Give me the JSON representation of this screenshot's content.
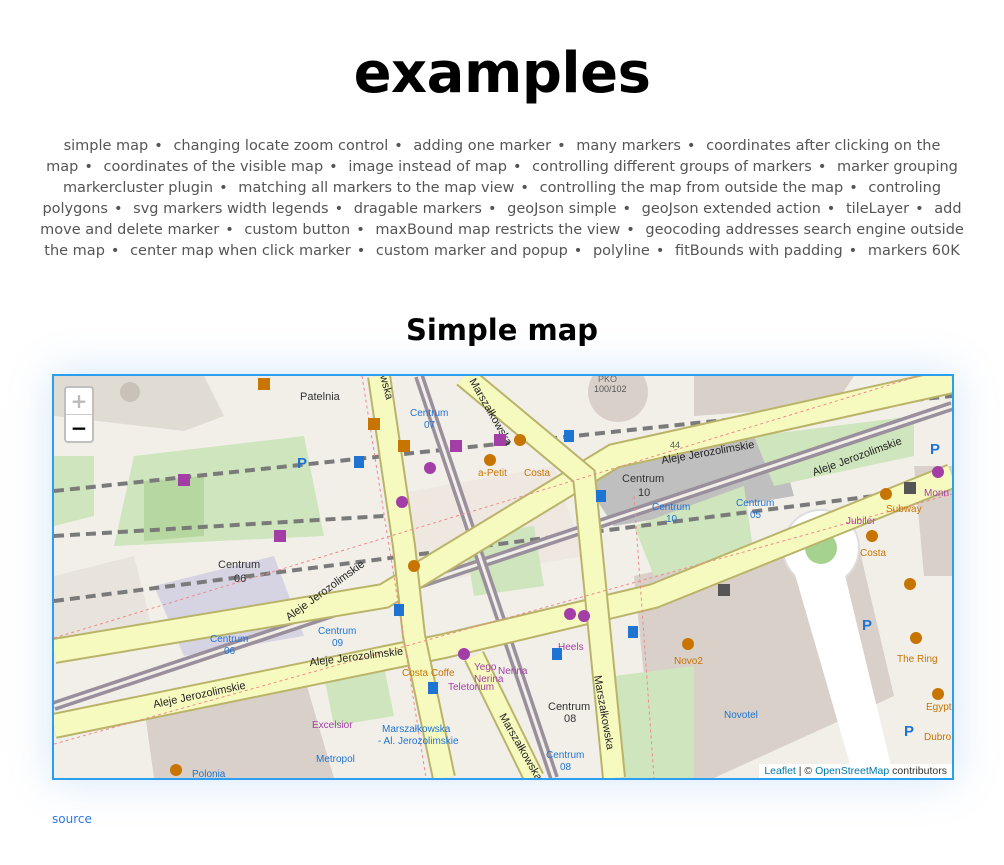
{
  "page": {
    "title": "examples",
    "subtitle": "Simple map",
    "source_link": "source"
  },
  "nav": [
    "simple map",
    "changing locate zoom control",
    "adding one marker",
    "many markers",
    "coordinates after clicking on the map",
    "coordinates of the visible map",
    "image instead of map",
    "controlling different groups of markers",
    "marker grouping markercluster plugin",
    "matching all markers to the map view",
    "controlling the map from outside the map",
    "controling polygons",
    "svg markers width legends",
    "dragable markers",
    "geoJson simple",
    "geoJson extended action",
    "tileLayer",
    "add move and delete marker",
    "custom button",
    "maxBound map restricts the view",
    "geocoding addresses search engine outside the map",
    "center map when click marker",
    "custom marker and popup",
    "polyline",
    "fitBounds with padding",
    "markers 60K"
  ],
  "nav_separator": "•",
  "map": {
    "zoom_in": "+",
    "zoom_out": "−",
    "attribution": {
      "leaflet": "Leaflet",
      "sep": " | © ",
      "osm": "OpenStreetMap",
      "suffix": " contributors"
    },
    "labels": {
      "patelnia": "Patelnia",
      "centrum07": "Centrum",
      "centrum07n": "07",
      "centrum10": "Centrum",
      "centrum10n": "10",
      "centrum10b": "Centrum",
      "centrum10bn": "10",
      "centrum05": "Centrum",
      "centrum05n": "05",
      "centrum06": "Centrum",
      "centrum06n": "06",
      "centrum06b": "Centrum",
      "centrum06bn": "06",
      "centrum09": "Centrum",
      "centrum09n": "09",
      "centrum08": "Centrum",
      "centrum08n": "08",
      "centrum08b": "Centrum",
      "centrum08bn": "08",
      "aleje1": "Aleje Jerozolimskie",
      "aleje2": "Aleje Jerozolimskie",
      "aleje3": "Aleje Jerozolimskie",
      "aleje4": "Aleje Jerozolimskie",
      "aleje5": "Aleje Jerozolimskie",
      "marszalkowska1": "Marszałkowska",
      "marszalkowska2": "Marszałkowska",
      "marszalkowska3": "Marszałkowska",
      "marszalkowska4": "wska",
      "apetit": "a-Petit",
      "costa": "Costa",
      "costa2": "Costa",
      "subway": "Subway",
      "jubiler": "Jubiler",
      "monnari": "Monn",
      "novo2": "Novo2",
      "novotel": "Novotel",
      "thering": "The Ring",
      "egypt": "Egypt",
      "dubro": "Dubro",
      "excelsior": "Excelsior",
      "metropol": "Metropol",
      "polonia": "Polonia",
      "marsz_stop": "Marszałkowska",
      "marsz_stop2": "- Al. Jerozolimskie",
      "heels": "Heels",
      "yego": "Yego",
      "nerina": "Nerina",
      "nerina2": "Nerina",
      "teletorium": "Teletorium",
      "costacoffee": "Costa Coffe",
      "n100": "100/102",
      "n44": "44",
      "pko": "PKO"
    }
  },
  "colors": {
    "link": "#2a7ae2",
    "map_border": "#2a9ff0",
    "road_primary": "#f7fabf",
    "road_casing": "#b9b46a",
    "rail": "#9a8f9c",
    "building": "#d9d0c9",
    "park": "#c8e6b6",
    "poi_purple": "#a23ea6",
    "poi_blue": "#1f73d1",
    "poi_brown": "#c77400"
  }
}
